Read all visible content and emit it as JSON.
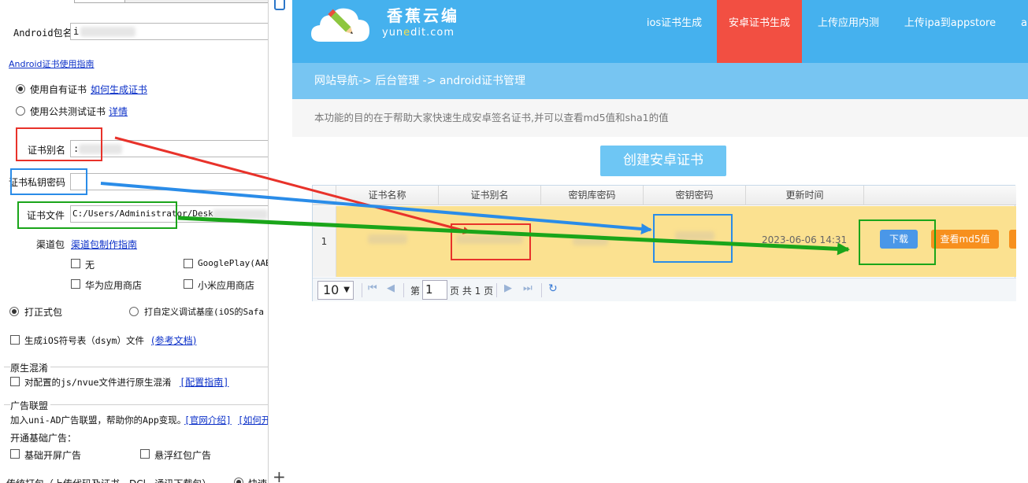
{
  "dialog": {
    "android_pkg_label": "Android包名",
    "android_pkg_value": "i",
    "cert_guide_link": "Android证书使用指南",
    "own_cert_label": "使用自有证书",
    "own_cert_link": "如何生成证书",
    "public_cert_label": "使用公共测试证书",
    "public_cert_link": "详情",
    "alias_label": "证书别名",
    "alias_value": ":",
    "key_pwd_label": "证书私钥密码",
    "cert_file_label": "证书文件",
    "cert_file_value": "C:/Users/Administrator/Desk",
    "channel_label": "渠道包",
    "channel_link": "渠道包制作指南",
    "channels": [
      "无",
      "GooglePlay(AAB)",
      "华为应用商店",
      "小米应用商店"
    ],
    "formal_pkg_label": "打正式包",
    "custom_base_label": "打自定义调试基座(iOS的Safa",
    "dsym_label": "生成iOS符号表（dsym）文件",
    "dsym_link": "(参考文档)",
    "native_obf_title": "原生混淆",
    "native_obf_label": "对配置的js/nvue文件进行原生混淆",
    "native_obf_link": "[配置指南]",
    "ad_title": "广告联盟",
    "ad_desc": "加入uni-AD广告联盟，帮助你的App变现。",
    "ad_link1": "[官网介绍]",
    "ad_link2": "[如何开",
    "ad_basic_title": "开通基础广告：",
    "ad_splash_label": "基础开屏广告",
    "ad_redpack_label": "悬浮红包广告",
    "bottom_cut_text": "传统打包（上传代码及证书，DCl...通讯下载包）",
    "bottom_fast_label": "快速"
  },
  "site": {
    "brand": "香蕉云编",
    "brand_sub_pre": "yun",
    "brand_sub_e": "e",
    "brand_sub_post": "dit.com",
    "nav": [
      "ios证书生成",
      "安卓证书生成",
      "上传应用内测",
      "上传ipa到appstore",
      "a"
    ],
    "active_nav": "安卓证书生成",
    "breadcrumb": "网站导航-> 后台管理 -> android证书管理",
    "description": "本功能的目的在于帮助大家快速生成安卓签名证书,并可以查看md5值和sha1的值",
    "create_button": "创建安卓证书",
    "table": {
      "columns": [
        "证书名称",
        "证书别名",
        "密钥库密码",
        "密钥密码",
        "更新时间"
      ],
      "rows": [
        {
          "index": "1",
          "update_time": "2023-06-06 14:31"
        }
      ],
      "download_button": "下载",
      "md5_button": "查看md5值"
    },
    "pager": {
      "page_size": "10",
      "page_prefix": "第",
      "page_current": "1",
      "page_suffix": "页 共 1 页"
    }
  },
  "colors": {
    "topbar": "#45b1ee",
    "active_nav": "#f24f42",
    "breadcrumb": "#77c5f2",
    "highlight_row": "#fbe190",
    "annot_red": "#e8322a",
    "annot_blue": "#2a8ce8",
    "annot_green": "#1aa51a"
  }
}
